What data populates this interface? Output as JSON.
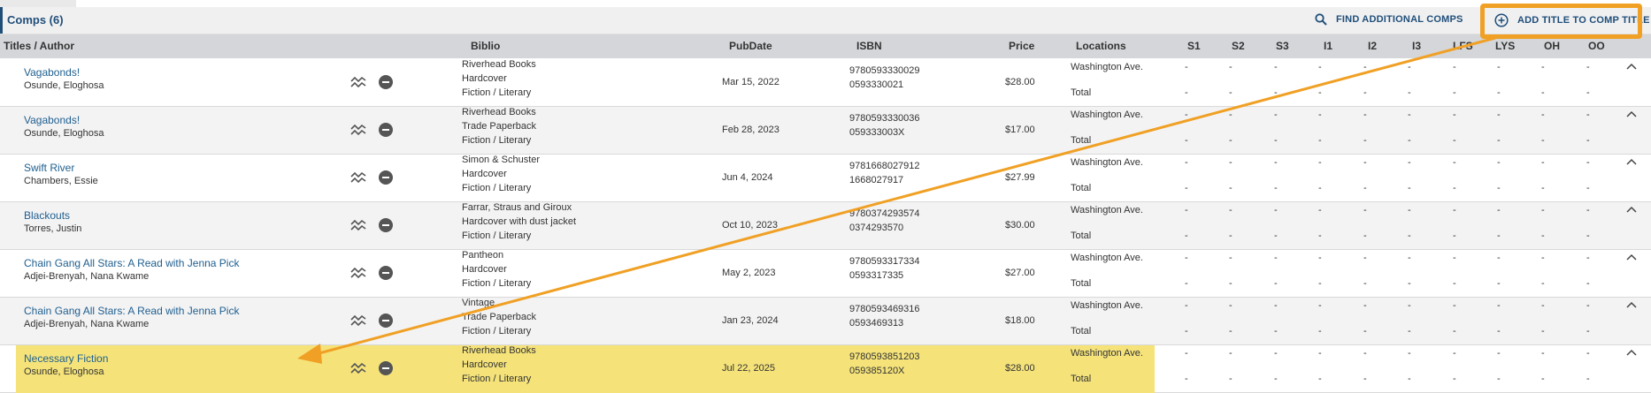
{
  "panel": {
    "title": "Comps (6)",
    "find_label": "FIND ADDITIONAL COMPS",
    "add_label": "ADD TITLE TO COMP TITLE"
  },
  "columns": [
    "Titles / Author",
    "Biblio",
    "PubDate",
    "ISBN",
    "Price",
    "Locations",
    "S1",
    "S2",
    "S3",
    "I1",
    "I2",
    "I3",
    "LFS",
    "LYS",
    "OH",
    "OO"
  ],
  "location_total": "Total",
  "empty_value": "-",
  "accent_color": "#f0a024",
  "highlight_color": "#f5e37a",
  "rows": [
    {
      "title": "Vagabonds!",
      "author": "Osunde, Eloghosa",
      "publisher": "Riverhead Books",
      "format": "Hardcover",
      "genre": "Fiction / Literary",
      "pubdate": "Mar 15, 2022",
      "isbn13": "9780593330029",
      "isbn10": "0593330021",
      "price": "$28.00",
      "location": "Washington Ave."
    },
    {
      "title": "Vagabonds!",
      "author": "Osunde, Eloghosa",
      "publisher": "Riverhead Books",
      "format": "Trade Paperback",
      "genre": "Fiction / Literary",
      "pubdate": "Feb 28, 2023",
      "isbn13": "9780593330036",
      "isbn10": "059333003X",
      "price": "$17.00",
      "location": "Washington Ave."
    },
    {
      "title": "Swift River",
      "author": "Chambers, Essie",
      "publisher": "Simon & Schuster",
      "format": "Hardcover",
      "genre": "Fiction / Literary",
      "pubdate": "Jun 4, 2024",
      "isbn13": "9781668027912",
      "isbn10": "1668027917",
      "price": "$27.99",
      "location": "Washington Ave."
    },
    {
      "title": "Blackouts",
      "author": "Torres, Justin",
      "publisher": "Farrar, Straus and Giroux",
      "format": "Hardcover with dust jacket",
      "genre": "Fiction / Literary",
      "pubdate": "Oct 10, 2023",
      "isbn13": "9780374293574",
      "isbn10": "0374293570",
      "price": "$30.00",
      "location": "Washington Ave."
    },
    {
      "title": "Chain Gang All Stars: A Read with Jenna Pick",
      "author": "Adjei-Brenyah, Nana Kwame",
      "publisher": "Pantheon",
      "format": "Hardcover",
      "genre": "Fiction / Literary",
      "pubdate": "May 2, 2023",
      "isbn13": "9780593317334",
      "isbn10": "0593317335",
      "price": "$27.00",
      "location": "Washington Ave."
    },
    {
      "title": "Chain Gang All Stars: A Read with Jenna Pick",
      "author": "Adjei-Brenyah, Nana Kwame",
      "publisher": "Vintage",
      "format": "Trade Paperback",
      "genre": "Fiction / Literary",
      "pubdate": "Jan 23, 2024",
      "isbn13": "9780593469316",
      "isbn10": "0593469313",
      "price": "$18.00",
      "location": "Washington Ave."
    },
    {
      "title": "Necessary Fiction",
      "author": "Osunde, Eloghosa",
      "publisher": "Riverhead Books",
      "format": "Hardcover",
      "genre": "Fiction / Literary",
      "pubdate": "Jul 22, 2025",
      "isbn13": "9780593851203",
      "isbn10": "059385120X",
      "price": "$28.00",
      "location": "Washington Ave."
    }
  ]
}
